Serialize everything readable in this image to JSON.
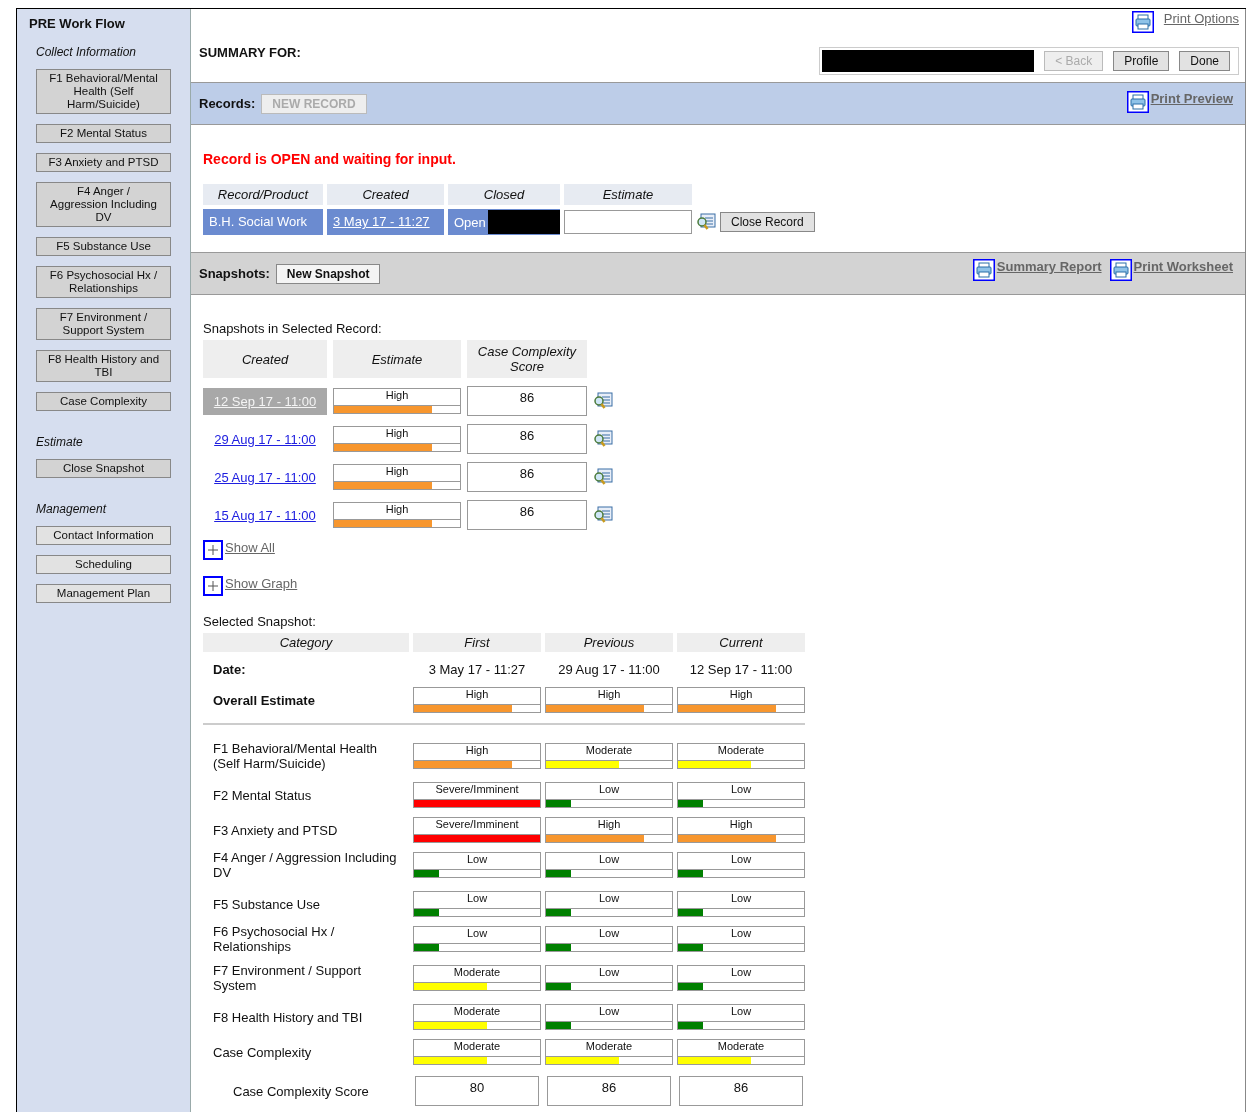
{
  "sidebar": {
    "title": "PRE Work Flow",
    "sections": [
      {
        "heading": "Collect Information",
        "items": [
          "F1 Behavioral/Mental Health (Self Harm/Suicide)",
          "F2 Mental Status",
          "F3 Anxiety and PTSD",
          "F4 Anger / Aggression Including DV",
          "F5 Substance Use",
          "F6 Psychosocial Hx / Relationships",
          "F7 Environment / Support System",
          "F8 Health History and TBI",
          "Case Complexity"
        ]
      },
      {
        "heading": "Estimate",
        "items": [
          "Close Snapshot"
        ]
      },
      {
        "heading": "Management",
        "items": [
          "Contact Information",
          "Scheduling",
          "Management Plan"
        ]
      }
    ]
  },
  "header": {
    "print_options": "Print Options",
    "summary_label": "SUMMARY FOR:",
    "redacted": true,
    "buttons": [
      {
        "label": "< Back",
        "disabled": true
      },
      {
        "label": "Profile",
        "disabled": false
      },
      {
        "label": "Done",
        "disabled": false
      }
    ]
  },
  "records_bar": {
    "label": "Records:",
    "new_button": {
      "label": "NEW RECORD",
      "disabled": true
    },
    "print_preview": "Print Preview"
  },
  "record": {
    "status": "Record is OPEN and waiting for input.",
    "columns": [
      "Record/Product",
      "Created",
      "Closed",
      "Estimate"
    ],
    "row": {
      "product": "B.H. Social Work",
      "created": "3 May 17 - 11:27",
      "closed": "Open",
      "closed_redacted": true
    },
    "close_button": "Close Record"
  },
  "snapshots_bar": {
    "label": "Snapshots:",
    "new_button": "New Snapshot",
    "links": [
      "Summary Report",
      "Print Worksheet"
    ]
  },
  "snapshots": {
    "heading": "Snapshots in Selected Record:",
    "columns": [
      "Created",
      "Estimate",
      "Case Complexity Score"
    ],
    "rows": [
      {
        "created": "12 Sep 17 - 11:00",
        "selected": true,
        "estimate": {
          "label": "High",
          "level": 0.78,
          "color": "#f7962e"
        },
        "score": "86"
      },
      {
        "created": "29 Aug 17 - 11:00",
        "selected": false,
        "estimate": {
          "label": "High",
          "level": 0.78,
          "color": "#f7962e"
        },
        "score": "86"
      },
      {
        "created": "25 Aug 17 - 11:00",
        "selected": false,
        "estimate": {
          "label": "High",
          "level": 0.78,
          "color": "#f7962e"
        },
        "score": "86"
      },
      {
        "created": "15 Aug 17 - 11:00",
        "selected": false,
        "estimate": {
          "label": "High",
          "level": 0.78,
          "color": "#f7962e"
        },
        "score": "86"
      }
    ],
    "toggles": [
      "Show All",
      "Show Graph"
    ]
  },
  "selected_snapshot": {
    "heading": "Selected Snapshot:",
    "columns": [
      "Category",
      "First",
      "Previous",
      "Current"
    ],
    "date_label": "Date:",
    "dates": [
      "3 May 17 - 11:27",
      "29 Aug 17 - 11:00",
      "12 Sep 17 - 11:00"
    ],
    "overall_label": "Overall Estimate",
    "overall": [
      {
        "label": "High",
        "level": 0.78,
        "color": "#f7962e"
      },
      {
        "label": "High",
        "level": 0.78,
        "color": "#f7962e"
      },
      {
        "label": "High",
        "level": 0.78,
        "color": "#f7962e"
      }
    ],
    "rows": [
      {
        "category": "F1 Behavioral/Mental Health (Self Harm/Suicide)",
        "values": [
          {
            "label": "High",
            "level": 0.78,
            "color": "#f7962e"
          },
          {
            "label": "Moderate",
            "level": 0.58,
            "color": "#ffff00"
          },
          {
            "label": "Moderate",
            "level": 0.58,
            "color": "#ffff00"
          }
        ]
      },
      {
        "category": "F2 Mental Status",
        "values": [
          {
            "label": "Severe/Imminent",
            "level": 1,
            "color": "#ff0000"
          },
          {
            "label": "Low",
            "level": 0.2,
            "color": "#008000"
          },
          {
            "label": "Low",
            "level": 0.2,
            "color": "#008000"
          }
        ]
      },
      {
        "category": "F3 Anxiety and PTSD",
        "values": [
          {
            "label": "Severe/Imminent",
            "level": 1,
            "color": "#ff0000"
          },
          {
            "label": "High",
            "level": 0.78,
            "color": "#f7962e"
          },
          {
            "label": "High",
            "level": 0.78,
            "color": "#f7962e"
          }
        ]
      },
      {
        "category": "F4 Anger / Aggression Including DV",
        "values": [
          {
            "label": "Low",
            "level": 0.2,
            "color": "#008000"
          },
          {
            "label": "Low",
            "level": 0.2,
            "color": "#008000"
          },
          {
            "label": "Low",
            "level": 0.2,
            "color": "#008000"
          }
        ]
      },
      {
        "category": "F5 Substance Use",
        "values": [
          {
            "label": "Low",
            "level": 0.2,
            "color": "#008000"
          },
          {
            "label": "Low",
            "level": 0.2,
            "color": "#008000"
          },
          {
            "label": "Low",
            "level": 0.2,
            "color": "#008000"
          }
        ]
      },
      {
        "category": "F6 Psychosocial Hx / Relationships",
        "values": [
          {
            "label": "Low",
            "level": 0.2,
            "color": "#008000"
          },
          {
            "label": "Low",
            "level": 0.2,
            "color": "#008000"
          },
          {
            "label": "Low",
            "level": 0.2,
            "color": "#008000"
          }
        ]
      },
      {
        "category": "F7 Environment / Support System",
        "values": [
          {
            "label": "Moderate",
            "level": 0.58,
            "color": "#ffff00"
          },
          {
            "label": "Low",
            "level": 0.2,
            "color": "#008000"
          },
          {
            "label": "Low",
            "level": 0.2,
            "color": "#008000"
          }
        ]
      },
      {
        "category": "F8 Health History and TBI",
        "values": [
          {
            "label": "Moderate",
            "level": 0.58,
            "color": "#ffff00"
          },
          {
            "label": "Low",
            "level": 0.2,
            "color": "#008000"
          },
          {
            "label": "Low",
            "level": 0.2,
            "color": "#008000"
          }
        ]
      },
      {
        "category": "Case Complexity",
        "values": [
          {
            "label": "Moderate",
            "level": 0.58,
            "color": "#ffff00"
          },
          {
            "label": "Moderate",
            "level": 0.58,
            "color": "#ffff00"
          },
          {
            "label": "Moderate",
            "level": 0.58,
            "color": "#ffff00"
          }
        ]
      }
    ],
    "score_label": "Case Complexity Score",
    "scores": [
      "80",
      "86",
      "86"
    ]
  }
}
